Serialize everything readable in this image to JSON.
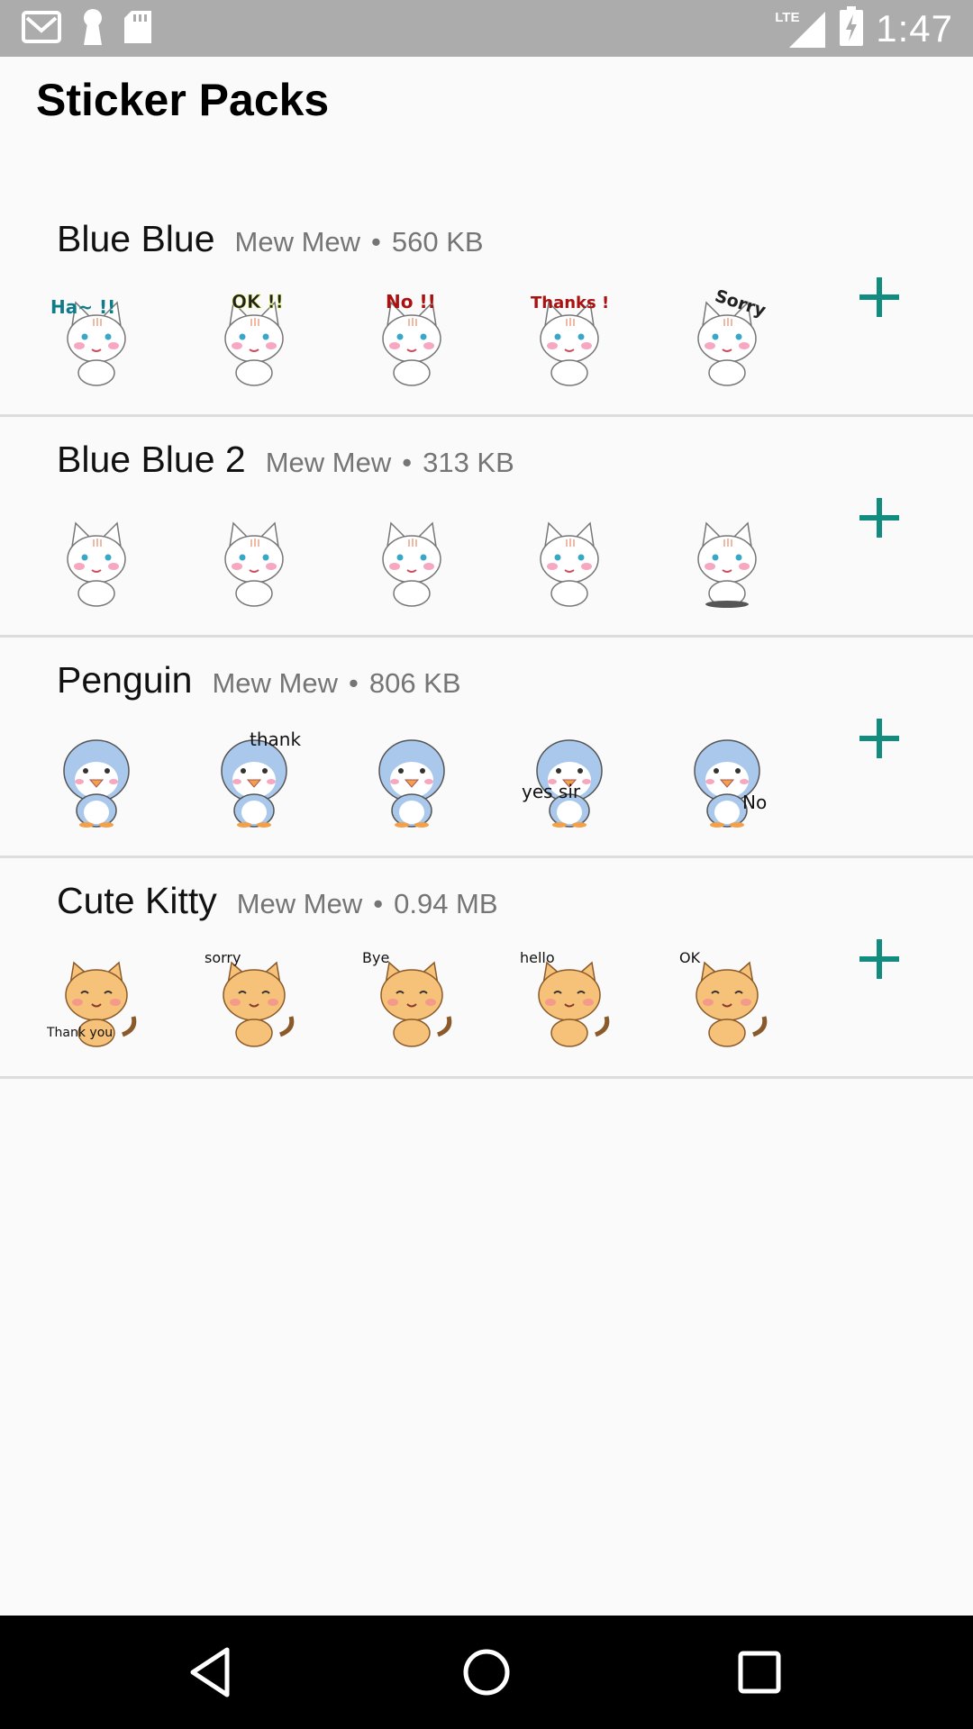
{
  "status_bar": {
    "icons_left": [
      "gmail-icon",
      "keyhole-icon",
      "sd-card-icon"
    ],
    "network": "LTE",
    "time": "1:47"
  },
  "header": {
    "title": "Sticker Packs"
  },
  "packs": [
    {
      "name": "Blue Blue",
      "publisher": "Mew Mew",
      "size": "560 KB",
      "character": "white-cat",
      "sticker_labels": [
        "Ha~ !!",
        "OK !!",
        "No !!",
        "Thanks !",
        "Sorry"
      ]
    },
    {
      "name": "Blue Blue 2",
      "publisher": "Mew Mew",
      "size": "313 KB",
      "character": "white-cat",
      "sticker_labels": [
        "",
        "",
        "",
        "",
        ""
      ]
    },
    {
      "name": "Penguin",
      "publisher": "Mew Mew",
      "size": "806 KB",
      "character": "penguin",
      "sticker_labels": [
        "",
        "thank you",
        "",
        "yes sir",
        "No"
      ]
    },
    {
      "name": "Cute Kitty",
      "publisher": "Mew Mew",
      "size": "0.94 MB",
      "character": "orange-cat",
      "sticker_labels": [
        "Thank you",
        "sorry",
        "Bye",
        "hello",
        "OK"
      ]
    }
  ],
  "separator": "•",
  "colors": {
    "accent": "#128c7e",
    "status_bar": "#acacac",
    "secondary_text": "#757575",
    "background": "#fafafa"
  },
  "nav": {
    "icons": [
      "back-icon",
      "home-icon",
      "recents-icon"
    ]
  }
}
